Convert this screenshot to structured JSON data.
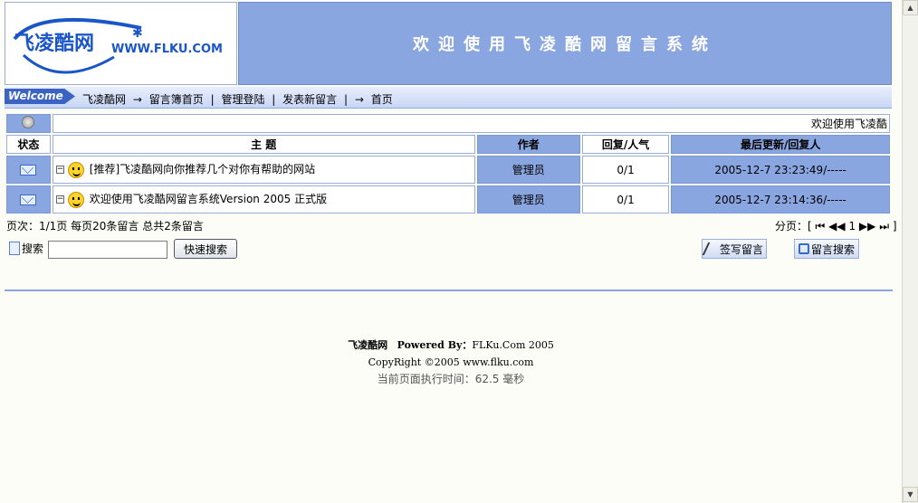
{
  "logo": {
    "site_name": "飞凌酷网",
    "domain": "WWW.FLKU.COM"
  },
  "banner": {
    "title": "欢迎使用飞凌酷网留言系统"
  },
  "nav": {
    "welcome": "Welcome",
    "items": [
      {
        "label": "飞凌酷网"
      },
      {
        "label": "→"
      },
      {
        "label": "留言簿首页"
      },
      {
        "label": "|"
      },
      {
        "label": "管理登陆"
      },
      {
        "label": "|"
      },
      {
        "label": "发表新留言"
      },
      {
        "label": "|"
      },
      {
        "label": "→"
      },
      {
        "label": "首页"
      }
    ]
  },
  "board": {
    "welcome_text": "欢迎使用飞凌酷",
    "headers": {
      "status": "状态",
      "topic": "主 题",
      "author": "作者",
      "replies": "回复/人气",
      "updated": "最后更新/回复人"
    },
    "rows": [
      {
        "topic": "[推荐]飞凌酷网向你推荐几个对你有帮助的网站",
        "author": "管理员",
        "replies": "0/1",
        "updated": "2005-12-7 23:23:49/-----"
      },
      {
        "topic": "欢迎使用飞凌酷网留言系统Version 2005 正式版",
        "author": "管理员",
        "replies": "0/1",
        "updated": "2005-12-7 23:14:36/-----"
      }
    ]
  },
  "pagination": {
    "info": "页次：1/1页 每页20条留言 总共2条留言",
    "label": "分页：[",
    "current": "1",
    "end": "]"
  },
  "search": {
    "label": "搜索",
    "placeholder": "",
    "quick_button": "快速搜索",
    "sign_button": "签写留言",
    "search_button": "留言搜索"
  },
  "footer": {
    "site": "飞凌酷网",
    "powered_label": "Powered By：",
    "powered_value": "FLKu.Com 2005",
    "copyright": "CopyRight ©2005 www.flku.com",
    "exec_time": "当前页面执行时间：62.5 毫秒"
  },
  "colors": {
    "accent": "#8aa6e0",
    "border": "#9aaed9",
    "background": "#fbfdf6"
  }
}
